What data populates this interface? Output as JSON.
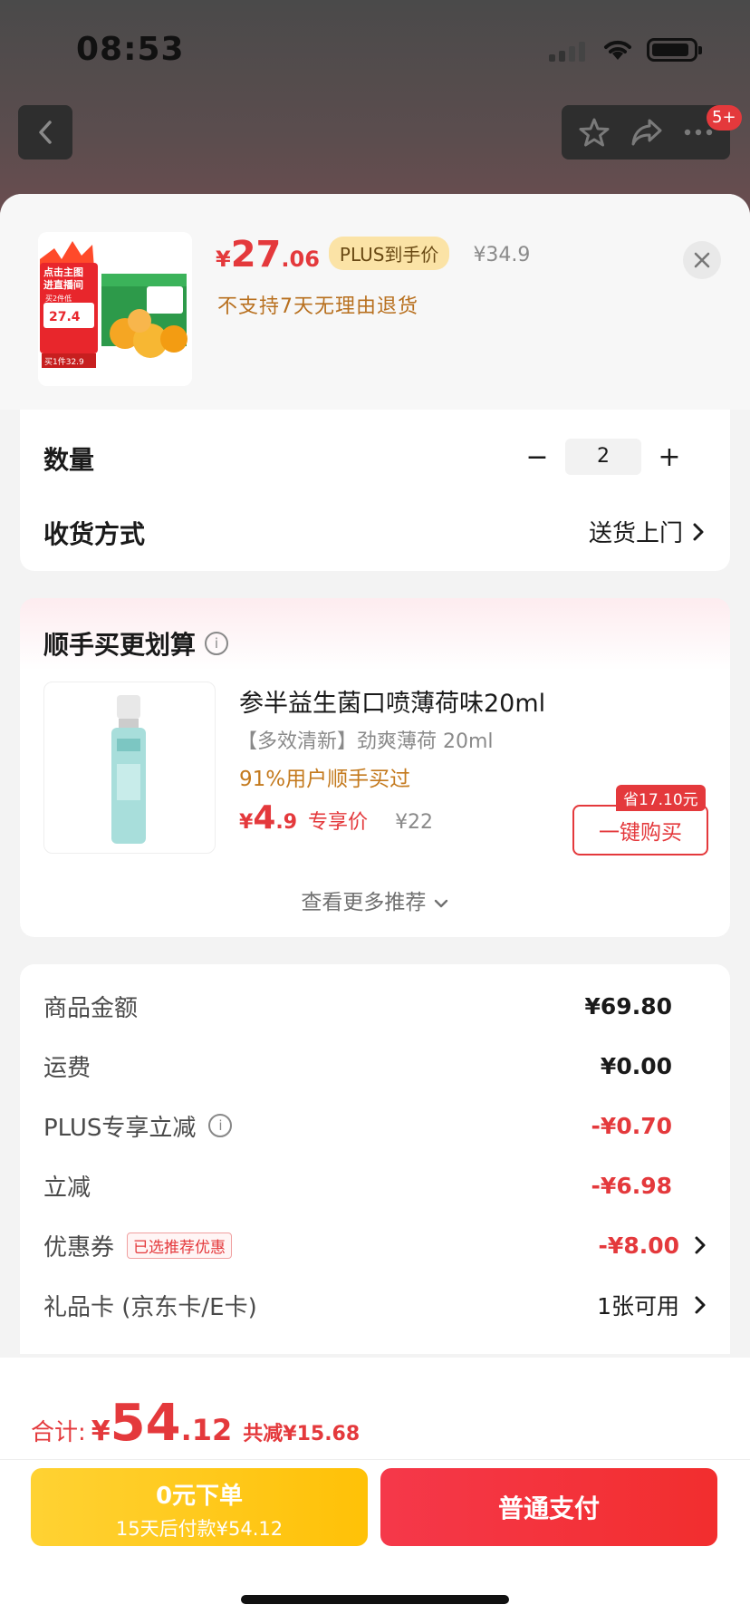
{
  "status_bar": {
    "time": "08:53"
  },
  "nav": {
    "badge": "5+"
  },
  "product": {
    "thumb_texts": [
      "点击主图",
      "进直播间",
      "买2件低",
      "27.4",
      "买1件32.9"
    ],
    "price_symbol": "¥",
    "price_int": "27",
    "price_dec": ".06",
    "plus_tag": "PLUS到手价",
    "original_price": "¥34.9",
    "return_policy": "不支持7天无理由退货"
  },
  "quantity": {
    "label": "数量",
    "value": "2",
    "minus": "−",
    "plus": "+"
  },
  "delivery": {
    "label": "收货方式",
    "value": "送货上门"
  },
  "recommend": {
    "title": "顺手买更划算",
    "item": {
      "name": "参半益生菌口喷薄荷味20ml",
      "subtitle": "【多效清新】劲爽薄荷 20ml",
      "rate": "91%用户顺手买过",
      "price_symbol": "¥",
      "price_int": "4",
      "price_dec": ".9",
      "price_label": "专享价",
      "old_price": "¥22",
      "save_tag": "省17.10元",
      "buy_label": "一键购买"
    },
    "more": "查看更多推荐"
  },
  "summary": {
    "rows": [
      {
        "label": "商品金额",
        "value": "¥69.80"
      },
      {
        "label": "运费",
        "value": "¥0.00"
      },
      {
        "label": "PLUS专享立减",
        "value": "-¥0.70"
      },
      {
        "label": "立减",
        "value": "-¥6.98"
      },
      {
        "label": "优惠券",
        "tag": "已选推荐优惠",
        "value": "-¥8.00"
      },
      {
        "label": "礼品卡 (京东卡/E卡)",
        "value": "1张可用"
      }
    ]
  },
  "footer": {
    "total_label": "合计:",
    "total_symbol": "¥",
    "total_int": "54",
    "total_dec": ".12",
    "total_cut": "共减¥15.68",
    "zero_title": "0元下单",
    "zero_sub": "15天后付款¥54.12",
    "pay_label": "普通支付"
  },
  "colors": {
    "accent": "#e4393c",
    "plus_gold": "#fbe3a6",
    "zero_btn": "#ffc107",
    "rate_text": "#c47a1e"
  },
  "icons": [
    "back-icon",
    "star-icon",
    "share-icon",
    "more-icon",
    "close-icon",
    "chevron-right-icon",
    "info-icon",
    "chevron-down-icon"
  ]
}
